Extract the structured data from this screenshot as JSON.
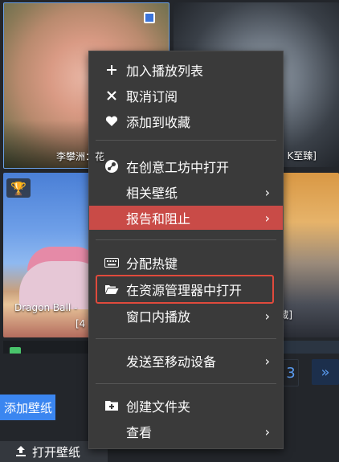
{
  "tiles": {
    "tile1_caption": "李攀洲：花",
    "tile2_caption": "K至臻]",
    "tile3_caption": "Dragon Ball -",
    "tile3_subcaption": "[4",
    "tile4_caption": "藏]"
  },
  "bottom": {
    "add_wallpaper": "添加壁纸",
    "open_wallpaper": "打开壁纸",
    "pager_page": "3",
    "pager_next": "»"
  },
  "menu": {
    "items": [
      {
        "icon": "plus-icon",
        "glyph": "+",
        "label": "加入播放列表"
      },
      {
        "icon": "close-icon",
        "glyph": "✕",
        "label": "取消订阅"
      },
      {
        "icon": "heart-icon",
        "glyph": "♥",
        "label": "添加到收藏"
      },
      {
        "icon": "steam-icon",
        "glyph": "◉",
        "label": "在创意工坊中打开"
      },
      {
        "icon": "",
        "glyph": "",
        "label": "相关壁纸",
        "submenu": true
      },
      {
        "icon": "",
        "glyph": "",
        "label": "报告和阻止",
        "submenu": true,
        "highlighted": true
      },
      {
        "icon": "keyboard-icon",
        "glyph": "⌨",
        "label": "分配热键"
      },
      {
        "icon": "folder-open-icon",
        "glyph": "📂",
        "label": "在资源管理器中打开"
      },
      {
        "icon": "",
        "glyph": "",
        "label": "窗口内播放",
        "submenu": true
      },
      {
        "icon": "",
        "glyph": "",
        "label": "发送至移动设备",
        "submenu": true
      },
      {
        "icon": "folder-plus-icon",
        "glyph": "+",
        "label": "创建文件夹"
      },
      {
        "icon": "",
        "glyph": "",
        "label": "查看",
        "submenu": true
      }
    ],
    "arrow_glyph": "›"
  },
  "colors": {
    "menu_bg": "#3a3a3a",
    "highlight": "#c94b47",
    "focus_outline": "#e04a3c",
    "accent_blue": "#3b86f0"
  }
}
